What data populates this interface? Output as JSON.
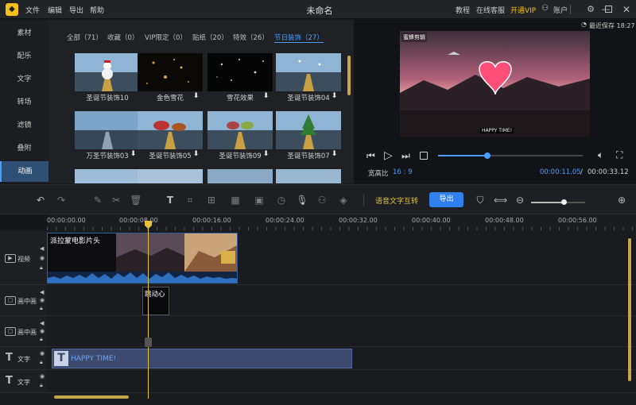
{
  "titlebar": {
    "app_title": "未命名",
    "menu": [
      "文件",
      "编辑",
      "导出",
      "帮助"
    ],
    "links": {
      "tutorial": "教程",
      "support": "在线客服",
      "vip": "开通VIP",
      "account": "账户"
    }
  },
  "sidebar": {
    "items": [
      "素材",
      "配乐",
      "文字",
      "转场",
      "滤镜",
      "叠附",
      "动画"
    ],
    "active_index": 6
  },
  "library": {
    "tabs": [
      "全部（71）",
      "收藏（0）",
      "VIP限定（0）",
      "贴纸（20）",
      "特效（26）",
      "节日装饰（27）"
    ],
    "active_tab_index": 5,
    "tiles": [
      {
        "label": "圣诞节装饰10",
        "download": false
      },
      {
        "label": "金色雪花",
        "download": true
      },
      {
        "label": "雪花效果",
        "download": true
      },
      {
        "label": "圣诞节装饰04",
        "download": true
      },
      {
        "label": "万圣节装饰03",
        "download": true
      },
      {
        "label": "圣诞节装饰05",
        "download": true
      },
      {
        "label": "圣诞节装饰09",
        "download": true
      },
      {
        "label": "圣诞节装饰07",
        "download": true
      }
    ]
  },
  "preview": {
    "autosave": "最近保存 18:27",
    "watermark": "蜜蜂剪辑",
    "caption": "HAPPY TIME!",
    "aspect_label": "宽高比",
    "aspect_value": "16 : 9",
    "current_time": "00:00:11.05",
    "separator": "/",
    "total_time": "00:00:33.12",
    "progress": 0.34
  },
  "toolbar": {
    "speech_to_text": "语音文字互转",
    "export": "导出",
    "zoom_level": 0.6
  },
  "ruler": {
    "ticks": [
      "00:00:00.00",
      "00:00:08.00",
      "00:00:16.00",
      "00:00:24.00",
      "00:00:32.00",
      "00:00:40.00",
      "00:00:48.00",
      "00:00:56.00"
    ]
  },
  "tracks": {
    "video": {
      "label": "视频",
      "clip_title": "派拉蒙电影片头"
    },
    "pip1": {
      "label": "画中画",
      "clip_title": "跳动心"
    },
    "pip2": {
      "label": "画中画"
    },
    "text1": {
      "label": "文字",
      "clip_title": "HAPPY TIME!"
    },
    "text2": {
      "label": "文字"
    }
  },
  "colors": {
    "accent": "#4a9eff",
    "vip": "#f2c21a",
    "playhead": "#e3c23c",
    "text_clip": "#3b4a6e"
  }
}
